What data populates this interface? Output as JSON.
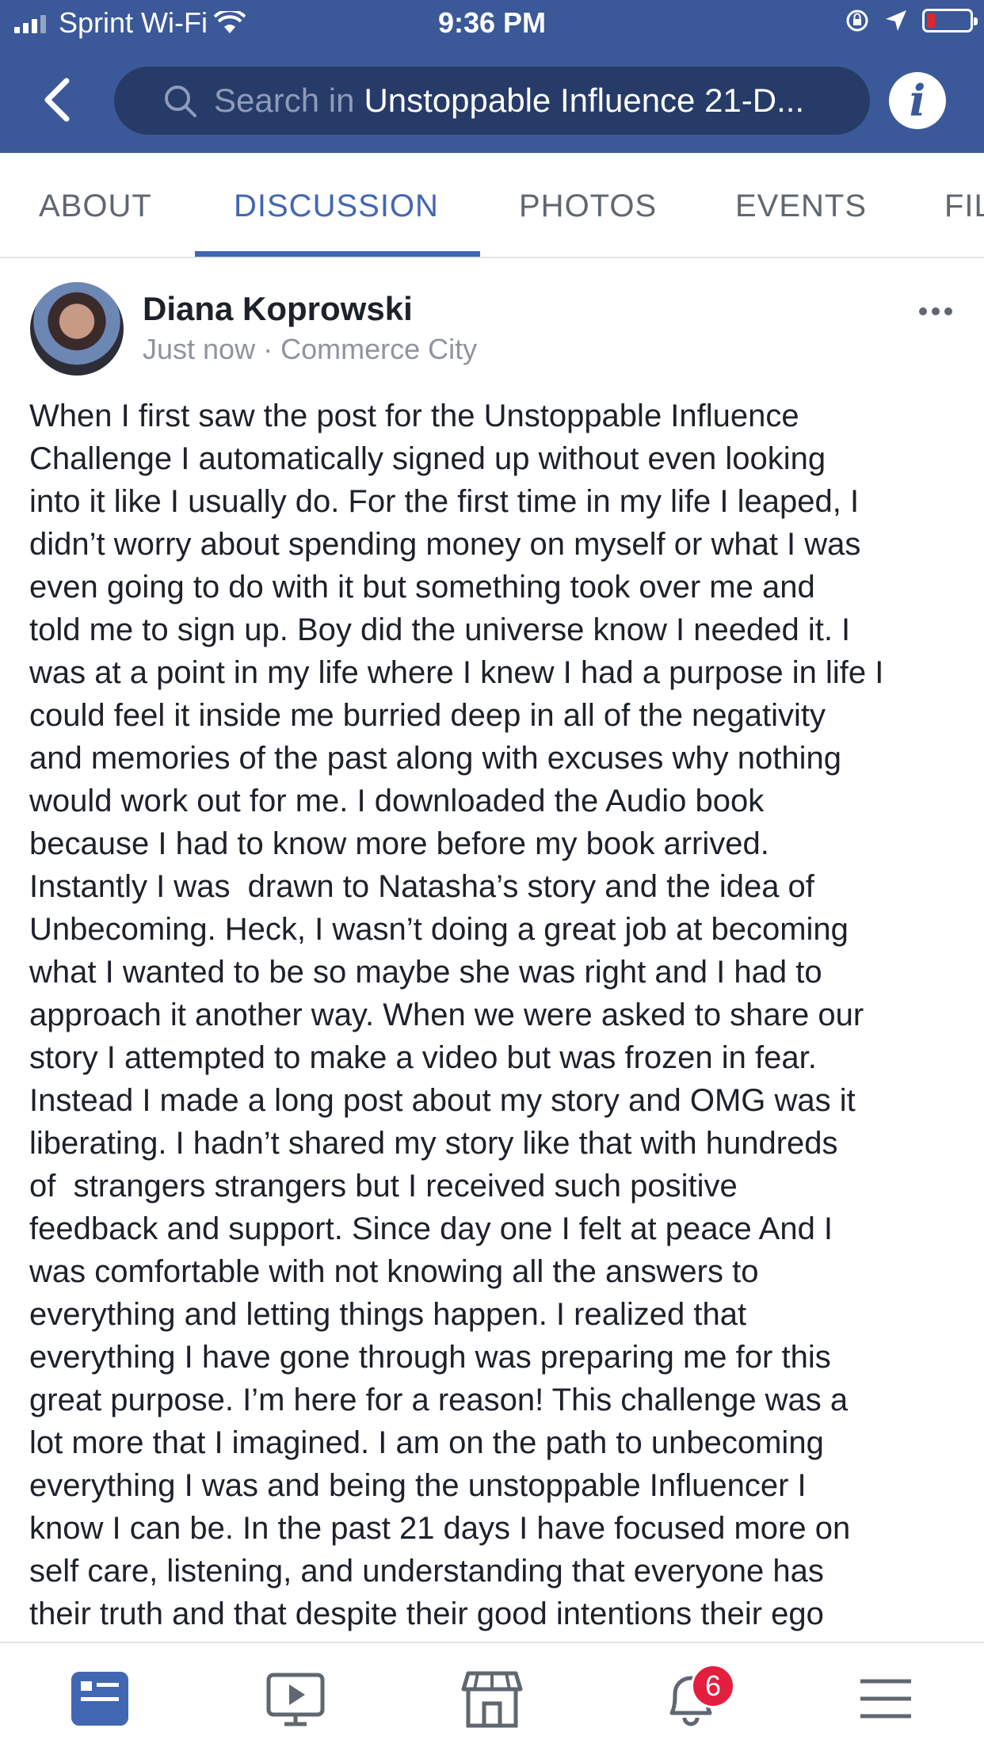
{
  "status_bar": {
    "carrier": "Sprint Wi-Fi",
    "time": "9:36 PM"
  },
  "header": {
    "search_placeholder": "Search in",
    "search_query": "Unstoppable Influence 21-D...",
    "info_icon_glyph": "i",
    "colors": {
      "bar": "#3b5998",
      "search_field": "#263b67"
    }
  },
  "tabs": [
    {
      "label": "ABOUT",
      "active": false
    },
    {
      "label": "DISCUSSION",
      "active": true
    },
    {
      "label": "PHOTOS",
      "active": false
    },
    {
      "label": "EVENTS",
      "active": false
    },
    {
      "label": "FILES",
      "active": false
    }
  ],
  "post": {
    "author": "Diana Koprowski",
    "time": "Just now",
    "separator": " · ",
    "location": "Commerce City",
    "lines": [
      "When I first saw the post for the Unstoppable Influence",
      "Challenge I automatically signed up without even looking",
      "into it like I usually do. For the first time in my life I leaped, I",
      "didn’t worry about spending money on myself or what I was",
      "even going to do with it but something took over me and",
      "told me to sign up. Boy did the universe know I needed it. I",
      "was at a point in my life where I knew I had a purpose in life I",
      "could feel it inside me burried deep in all of the negativity",
      "and memories of the past along with excuses why nothing",
      "would work out for me. I downloaded the Audio book",
      "because I had to know more before my book arrived.",
      "Instantly I was  drawn to Natasha’s story and the idea of",
      "Unbecoming. Heck, I wasn’t doing a great job at becoming",
      "what I wanted to be so maybe she was right and I had to",
      "approach it another way. When we were asked to share our",
      "story I attempted to make a video but was frozen in fear.",
      "Instead I made a long post about my story and OMG was it",
      "liberating. I hadn’t shared my story like that with hundreds",
      "of  strangers strangers but I received such positive",
      "feedback and support. Since day one I felt at peace And I",
      "was comfortable with not knowing all the answers to",
      "everything and letting things happen. I realized that",
      "everything I have gone through was preparing me for this",
      "great purpose. I’m here for a reason! This challenge was a",
      "lot more that I imagined. I am on the path to unbecoming",
      "everything I was and being the unstoppable Influencer I",
      "know I can be. In the past 21 days I have focused more on",
      "self care, listening, and understanding that everyone has",
      "their truth and that despite their good intentions their ego"
    ]
  },
  "bottom_nav": {
    "items": [
      "news-feed-icon",
      "watch-icon",
      "marketplace-icon",
      "notifications-icon",
      "menu-icon"
    ],
    "notification_count": "6",
    "active_color": "#4267b2"
  }
}
